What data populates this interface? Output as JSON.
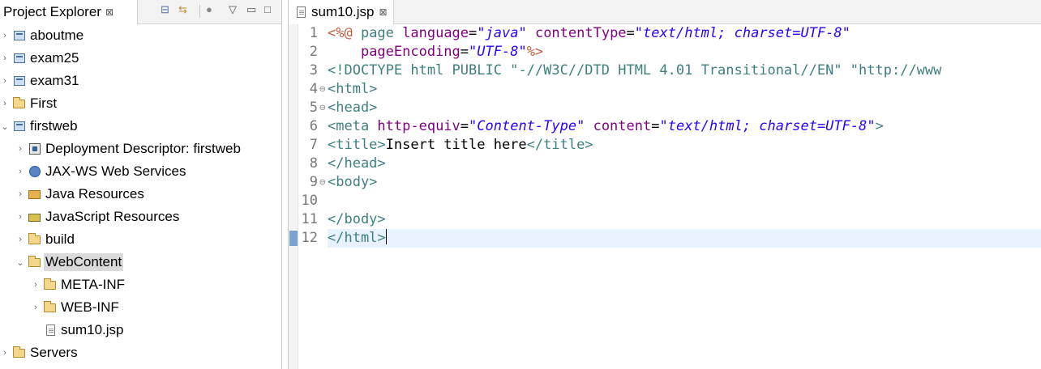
{
  "explorer": {
    "tab_label": "Project Explorer",
    "close_glyph": "⊠",
    "tree": [
      {
        "label": "aboutme",
        "icon": "project-icon",
        "twisty": "›",
        "depth": 0
      },
      {
        "label": "exam25",
        "icon": "project-icon",
        "twisty": "›",
        "depth": 0
      },
      {
        "label": "exam31",
        "icon": "project-icon",
        "twisty": "›",
        "depth": 0
      },
      {
        "label": "First",
        "icon": "folder-icon",
        "twisty": "›",
        "depth": 0
      },
      {
        "label": "firstweb",
        "icon": "project-icon",
        "twisty": "⌄",
        "depth": 0
      },
      {
        "label": "Deployment Descriptor: firstweb",
        "icon": "descriptor-icon",
        "twisty": "›",
        "depth": 1
      },
      {
        "label": "JAX-WS Web Services",
        "icon": "web-services-icon",
        "twisty": "›",
        "depth": 1
      },
      {
        "label": "Java Resources",
        "icon": "java-resources-icon",
        "twisty": "›",
        "depth": 1
      },
      {
        "label": "JavaScript Resources",
        "icon": "javascript-resources-icon",
        "twisty": "›",
        "depth": 1
      },
      {
        "label": "build",
        "icon": "folder-icon",
        "twisty": "›",
        "depth": 1
      },
      {
        "label": "WebContent",
        "icon": "folder-icon",
        "twisty": "⌄",
        "depth": 1,
        "selected": true
      },
      {
        "label": "META-INF",
        "icon": "folder-icon",
        "twisty": "›",
        "depth": 2
      },
      {
        "label": "WEB-INF",
        "icon": "folder-icon",
        "twisty": "›",
        "depth": 2
      },
      {
        "label": "sum10.jsp",
        "icon": "jsp-file-icon",
        "twisty": "",
        "depth": 2
      },
      {
        "label": "Servers",
        "icon": "folder-icon",
        "twisty": "›",
        "depth": 0
      }
    ]
  },
  "editor": {
    "tab_label": "sum10.jsp",
    "close_glyph": "⊠",
    "current_line": 12,
    "lines": [
      {
        "no": "1",
        "fold": "",
        "tokens": [
          [
            "tk-dir",
            "<%@ "
          ],
          [
            "tk-tag",
            "page "
          ],
          [
            "tk-attr",
            "language"
          ],
          [
            "tk-text",
            "="
          ],
          [
            "tk-str",
            "\"java\""
          ],
          [
            "tk-text",
            " "
          ],
          [
            "tk-attr",
            "contentType"
          ],
          [
            "tk-text",
            "="
          ],
          [
            "tk-str",
            "\"text/html; charset=UTF-8\""
          ]
        ]
      },
      {
        "no": "2",
        "fold": "",
        "tokens": [
          [
            "tk-text",
            "    "
          ],
          [
            "tk-attr",
            "pageEncoding"
          ],
          [
            "tk-text",
            "="
          ],
          [
            "tk-str",
            "\"UTF-8\""
          ],
          [
            "tk-dir",
            "%>"
          ]
        ]
      },
      {
        "no": "3",
        "fold": "",
        "tokens": [
          [
            "tk-doc",
            "<!DOCTYPE html PUBLIC "
          ],
          [
            "tk-docstr",
            "\"-//W3C//DTD HTML 4.01 Transitional//EN\" \"http://www"
          ]
        ]
      },
      {
        "no": "4",
        "fold": "⊖",
        "tokens": [
          [
            "tk-tag",
            "<html>"
          ]
        ]
      },
      {
        "no": "5",
        "fold": "⊖",
        "tokens": [
          [
            "tk-tag",
            "<head>"
          ]
        ]
      },
      {
        "no": "6",
        "fold": "",
        "tokens": [
          [
            "tk-tag",
            "<meta "
          ],
          [
            "tk-attr",
            "http-equiv"
          ],
          [
            "tk-text",
            "="
          ],
          [
            "tk-str",
            "\"Content-Type\""
          ],
          [
            "tk-text",
            " "
          ],
          [
            "tk-attr",
            "content"
          ],
          [
            "tk-text",
            "="
          ],
          [
            "tk-str",
            "\"text/html; charset=UTF-8\""
          ],
          [
            "tk-tag",
            ">"
          ]
        ]
      },
      {
        "no": "7",
        "fold": "",
        "tokens": [
          [
            "tk-tag",
            "<title>"
          ],
          [
            "tk-text",
            "Insert title here"
          ],
          [
            "tk-tag",
            "</title>"
          ]
        ]
      },
      {
        "no": "8",
        "fold": "",
        "tokens": [
          [
            "tk-tag",
            "</head>"
          ]
        ]
      },
      {
        "no": "9",
        "fold": "⊖",
        "tokens": [
          [
            "tk-tag",
            "<body>"
          ]
        ]
      },
      {
        "no": "10",
        "fold": "",
        "tokens": []
      },
      {
        "no": "11",
        "fold": "",
        "tokens": [
          [
            "tk-tag",
            "</body>"
          ]
        ]
      },
      {
        "no": "12",
        "fold": "",
        "tokens": [
          [
            "tk-tag",
            "</html>"
          ]
        ]
      }
    ]
  }
}
